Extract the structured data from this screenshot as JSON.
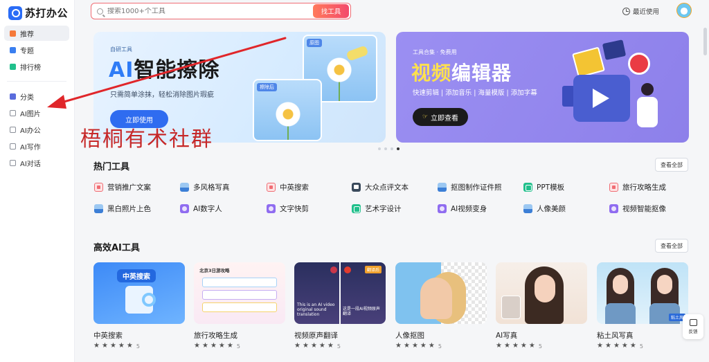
{
  "app": {
    "name": "苏打办公"
  },
  "search": {
    "placeholder": "搜索1000+个工具",
    "button": "找工具"
  },
  "header": {
    "recent": "最近使用"
  },
  "sidebar": {
    "items": [
      {
        "label": "推荐",
        "color": "#f5793a"
      },
      {
        "label": "专题",
        "color": "#3a7ff0"
      },
      {
        "label": "排行榜",
        "color": "#21c08c"
      },
      {
        "label": "分类",
        "color": "#5a6cdc"
      },
      {
        "label": "AI图片",
        "color": "#8a8f99"
      },
      {
        "label": "AI办公",
        "color": "#8a8f99"
      },
      {
        "label": "AI写作",
        "color": "#8a8f99"
      },
      {
        "label": "AI对话",
        "color": "#8a8f99"
      }
    ]
  },
  "banners": {
    "left": {
      "tag": "自研工具",
      "title_ai": "AI",
      "title_rest": "智能擦除",
      "subtitle": "只需简单涂抹，轻松消除图片瑕疵",
      "button": "立即使用",
      "before_label": "原图",
      "after_label": "擦除后"
    },
    "right": {
      "tag": "工具合集 · 免费用",
      "title_yellow": "视频",
      "title_white": "编辑器",
      "subtitle": "快速剪辑 | 添加音乐 | 海量模版 | 添加字幕",
      "button": "立即查看"
    }
  },
  "hot_tools": {
    "title": "热门工具",
    "view_all": "查看全部",
    "rows": [
      [
        {
          "label": "营销推广文案",
          "icon": "ti-red"
        },
        {
          "label": "多风格写真",
          "icon": "ti-blue"
        },
        {
          "label": "中英搜索",
          "icon": "ti-red"
        },
        {
          "label": "大众点评文本",
          "icon": "ti-dark"
        },
        {
          "label": "抠图制作证件照",
          "icon": "ti-blue"
        },
        {
          "label": "PPT模板",
          "icon": "ti-green"
        },
        {
          "label": "旅行攻略生成",
          "icon": "ti-red"
        }
      ],
      [
        {
          "label": "黑白照片上色",
          "icon": "ti-blue"
        },
        {
          "label": "AI数字人",
          "icon": "ti-purple"
        },
        {
          "label": "文字快剪",
          "icon": "ti-purple"
        },
        {
          "label": "艺术字设计",
          "icon": "ti-green"
        },
        {
          "label": "AI视频变身",
          "icon": "ti-purple"
        },
        {
          "label": "人像美颜",
          "icon": "ti-blue"
        },
        {
          "label": "视频智能抠像",
          "icon": "ti-purple"
        }
      ]
    ]
  },
  "efficient_tools": {
    "title": "高效AI工具",
    "view_all": "查看全部",
    "cards": [
      {
        "name": "中英搜索",
        "rating": "5",
        "thumb_text": "中英搜索"
      },
      {
        "name": "旅行攻略生成",
        "rating": "5",
        "thumb_text": "北京3日游攻略"
      },
      {
        "name": "视频原声翻译",
        "rating": "5",
        "thumb_text_left": "This is an AI video original sound translation",
        "thumb_text_right": "这是一段AI视频原声翻译",
        "badge": "翻译后"
      },
      {
        "name": "人像抠图",
        "rating": "5"
      },
      {
        "name": "AI写真",
        "rating": "5"
      },
      {
        "name": "粘土风写真",
        "rating": "5",
        "badge": "粘土风"
      }
    ]
  },
  "overlay": {
    "annotation": "梧桐有术社群"
  },
  "feedback": {
    "label": "反馈"
  },
  "carousel": {
    "slides": 4,
    "active": 4
  }
}
